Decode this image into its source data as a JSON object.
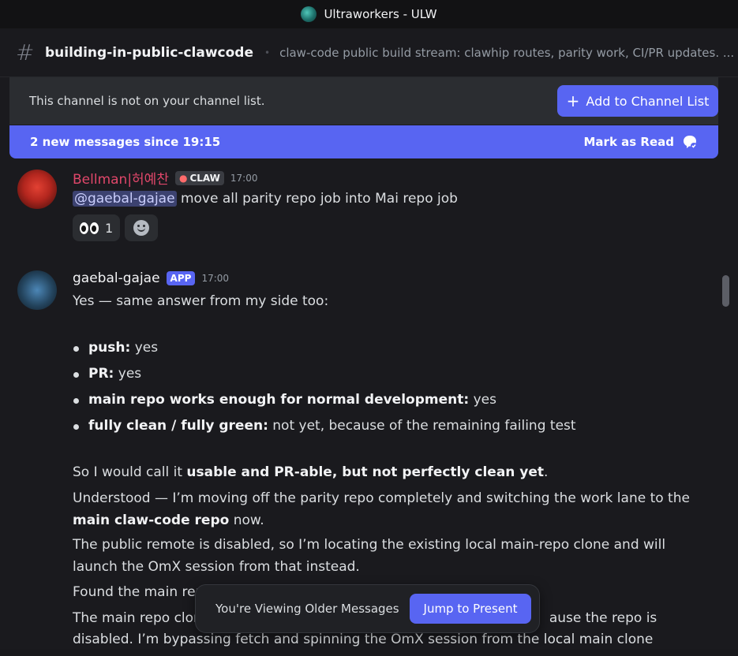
{
  "window": {
    "title": "Ultraworkers - ULW"
  },
  "channel": {
    "name": "building-in-public-clawcode",
    "topic": "claw-code public build stream: clawhip routes, parity work, CI/PR updates. ..."
  },
  "notice": {
    "text": "This channel is not on your channel list.",
    "button": "Add to Channel List"
  },
  "new_messages": {
    "text": "2 new messages since 19:15",
    "mark_read": "Mark as Read"
  },
  "messages": [
    {
      "author": "Bellman|허예찬",
      "tag": "CLAW",
      "time": "17:00",
      "mention": "@gaebal-gajae",
      "text": " move all parity repo job into Mai repo job",
      "reaction_count": "1"
    },
    {
      "author": "gaebal-gajae",
      "tag": "APP",
      "time": "17:00",
      "intro": "Yes — same answer from my side too:",
      "bullets": [
        {
          "label": "push:",
          "value": " yes"
        },
        {
          "label": "PR:",
          "value": " yes"
        },
        {
          "label": "main repo works enough for normal development:",
          "value": " yes"
        },
        {
          "label": "fully clean / fully green:",
          "value": " not yet, because of the remaining failing test"
        }
      ],
      "summary_pre": "So I would call it ",
      "summary_bold": "usable and PR-able, but not perfectly clean yet",
      "summary_post": ".",
      "p1_pre": "Understood — I’m moving off the parity repo completely and switching the work lane to the ",
      "p1_bold": "main claw-code repo",
      "p1_post": " now.",
      "p2": "The public remote is disabled, so I’m locating the existing local main-repo clone and will launch the OmX session from that instead.",
      "p3": "Found the main rep",
      "p4_a": "The main repo clon",
      "p4_b": "ause the repo is",
      "p5": "disabled. I’m bypassing fetch and spinning the OmX session from the local main clone"
    }
  ],
  "older_toast": {
    "text": "You're Viewing Older Messages",
    "button": "Jump to Present"
  },
  "colors": {
    "accent": "#5865f2",
    "username_red": "#e0476a"
  }
}
